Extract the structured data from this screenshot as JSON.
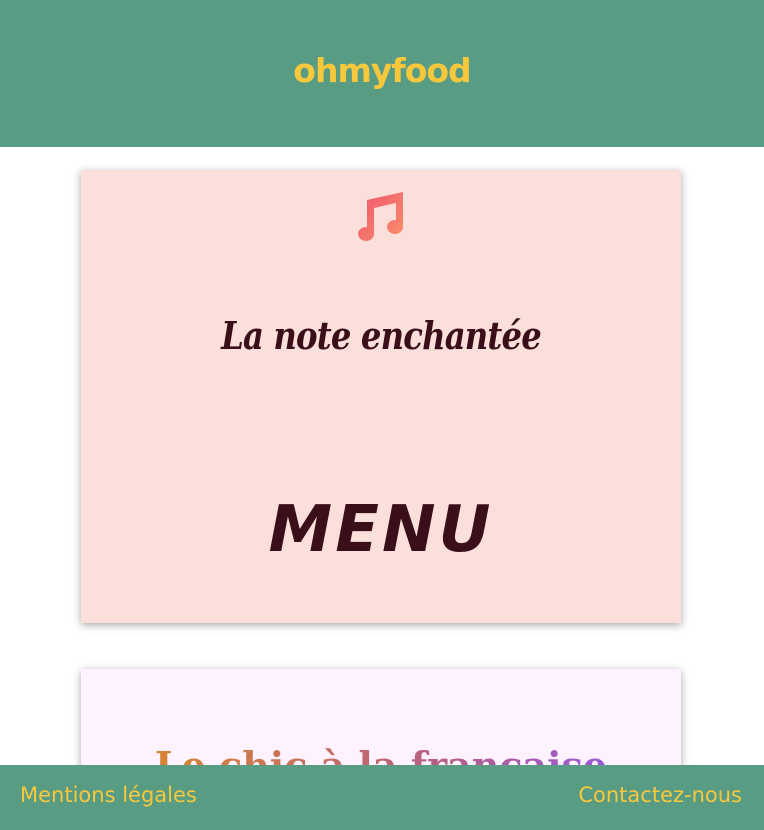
{
  "header": {
    "logo": "ohmyfood"
  },
  "menu_card": {
    "icon": "music-note-icon",
    "restaurant_name": "La note enchantée",
    "title": "MENU"
  },
  "dish_card": {
    "section_title": "Le chic à la française"
  },
  "footer": {
    "legal_label": "Mentions légales",
    "contact_label": "Contactez-nous"
  },
  "colors": {
    "header_bg": "#599c84",
    "accent_yellow": "#f7c83c",
    "menu_card_bg": "#fbdfdb",
    "dish_card_bg": "#fdf2fd",
    "text_dark": "#3b0f19"
  }
}
